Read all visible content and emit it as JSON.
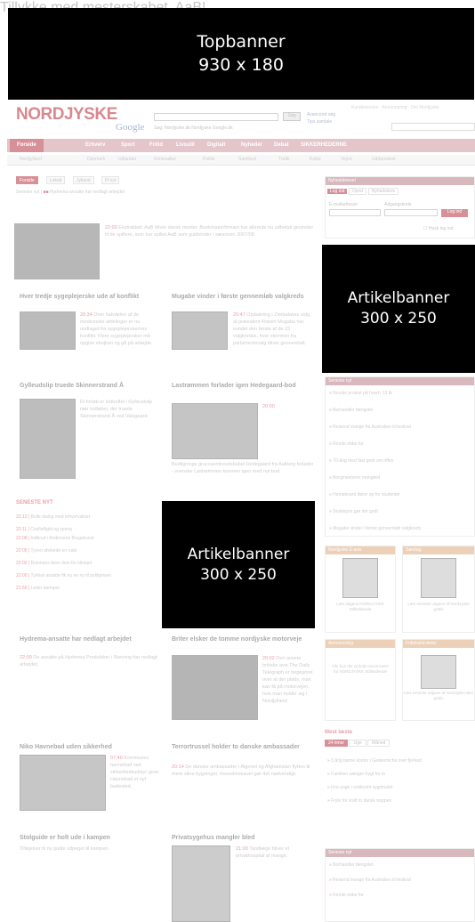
{
  "banners": {
    "top": {
      "line1": "Topbanner",
      "line2": "930 x 180"
    },
    "article1": {
      "line1": "Artikelbanner",
      "line2": "300 x 250"
    },
    "article2": {
      "line1": "Artikelbanner",
      "line2": "300 x 250"
    }
  },
  "header": {
    "logo": "NORDJYSKE",
    "google": "Google",
    "search_button": "Søg",
    "radios": "Søg: Nordjyske.dk  Nordjyske  Google.dk",
    "links": [
      "Avanceret søg",
      "Tips samtale"
    ]
  },
  "nav": {
    "items": [
      "Forside",
      "Erhverv",
      "Sport",
      "Fritid",
      "Livsstil",
      "Digitalt",
      "Nyheder",
      "Debat",
      "SIKKERHEDERNE"
    ]
  },
  "subnav": {
    "items": [
      "Nordjylland",
      "Danmark",
      "Udlandet",
      "Kriminalitet",
      "Politik",
      "Samfund",
      "Trafik",
      "Kultur",
      "Vejret",
      "Uddannelse"
    ]
  },
  "tabs": [
    "Forside",
    "Lokalt",
    "Jylland",
    "Fl nyt"
  ],
  "breaking": "Hydrema-ansatte har nedlagt arbejdet",
  "headline": {
    "title": "Tillykke med mesterskabet, AaB!",
    "time": "22:00",
    "text": "Ekstrablad: AaB bliver dansk mester. Bookmakerfirmaet har allerede nu udbetalt gevinster til de spillere, som har spillet AaB som guldvinder i sæsonen 2007/08"
  },
  "articles": [
    {
      "title": "Hver tredje sygeplejerske ude af konflikt",
      "time": "20:34",
      "text": "Over halvdelen af de medicinske afdelinger er nu undtaget fra sygeplejerskernes konflikt. Flere sygeplejersker må opgive strejken og gå på arbejde."
    },
    {
      "title": "Mugabe vinder i første gennemløb valgkreds",
      "time": "20:47",
      "text": "Opdateling i Zimbabwes valg, at præsident Robert Mugabe har vundet den første af de 23 valgkredse, hvor stemmer fra parlamentsvalg bliver gennemtalt."
    },
    {
      "title": "Gylleudslip truede Skinnerstrand Å",
      "time": "",
      "text": "Et forløb er indtruffet i Gylleudslip nær indløbet, der truede Skinnerstrand Å ved Valsgaard."
    },
    {
      "title": "Lastrømmen forlader igen Hedegaard-bod",
      "time": "20:00",
      "text": "Budlignings gruccaentreselskabet Hedegaard fra Aalborg forlader - svenske Lastrømmen kommer igen med nyt bud."
    }
  ],
  "latest": {
    "title": "SENESTE NYT",
    "items": [
      "Bolle dialog med erhvervslivet",
      "Cosfleflight og spring",
      "Indbrud i Andersens Brugskunst",
      "Tyven afsloede en rude",
      "Rusmans fører dem for klimaet",
      "Tyrkisk ansatte fik nu en ny til politiprisen",
      "Leder kæmpet"
    ]
  },
  "articles2": [
    {
      "title": "Hydrema-ansatte har nedlagt arbejdet",
      "time": "22:00",
      "text": "De ansatte på Hydrema Produktion i Støvring har nedlagt arbejdet."
    },
    {
      "title": "Briter elsker de tomme nordjyske motorveje",
      "time": "20:02",
      "text": "Den ansete britiske avis The Daily Telegraph er begejstret over at der plads, man kan få på motorvejen, hvis man holder sig i Nordjylland."
    },
    {
      "title": "Niko Havnebad uden sikkerhed",
      "time": "07:40",
      "text": "Kommunes havnebad ved sikkerhedsudstyr giver Havnebad et nyt badested."
    },
    {
      "title": "Terrortrussel holder to danske ambassader",
      "time": "20:14",
      "text": "De danske ambassader i Algeriet og Afghanistan flyttes til mere sikre bygninger, trusselniveauet gør det nødvendigt."
    },
    {
      "title": "Stolguide er holt ude i kampen",
      "time": "",
      "text": "Tilføjelser til ny guide udpeget til kampen."
    },
    {
      "title": "Privatsygehus mangler bled",
      "time": "21:00",
      "text": "Tandlæge bliver et privathospital af mange."
    }
  ],
  "sidebar": {
    "login_head": "Nyhedsbrevet",
    "login_tabs": [
      "Log ind",
      "Opret",
      "Nyhedsbrev"
    ],
    "fields": [
      "E-mailadresse",
      "Adgangskode"
    ],
    "login_button": "Log ind",
    "remember": "Husk log ind",
    "news_head": "Seneste nyt",
    "news": [
      "Norske protest på hvad i 13 år",
      "Borhandler fængslet",
      "Reisend mange fra Australien til festival",
      "Rende ebbe for",
      "70-årig med fast greb om riffen",
      "Borgmesteren mangleld",
      "Homeboard ifører op for studenter",
      "Studiepris gør det godt",
      "Mugabe vinder i første gennemløb valgkreds"
    ],
    "box_titles": [
      "Nordjyske E-avis",
      "Søndag",
      "Annoncering",
      "Fritidsaktiviteter"
    ],
    "box_texts": [
      "Læs dagens NORDJYSKE Stiftstidende",
      "Læs seneste udgave af NordJyske gratis",
      "Alle hun der at finde annoncører fra NORDJYSKE Stiftstidende",
      "Læs seneste udgave af NordJyske Bier gratis"
    ],
    "most_read": "Mest læste",
    "most_tabs": [
      "24 timer",
      "Uge",
      "Måned"
    ],
    "most_items": [
      "3 årig børne kontor i Gedesmiche over  fjerkod",
      "Familien sæsger frygt for to",
      "Fire unge i voldsomt sygehuset",
      "Fryle for kraft to dansk troppes"
    ]
  },
  "colors": {
    "accent": "#b02030",
    "nav": "#c88a95",
    "banner": "#000000"
  }
}
